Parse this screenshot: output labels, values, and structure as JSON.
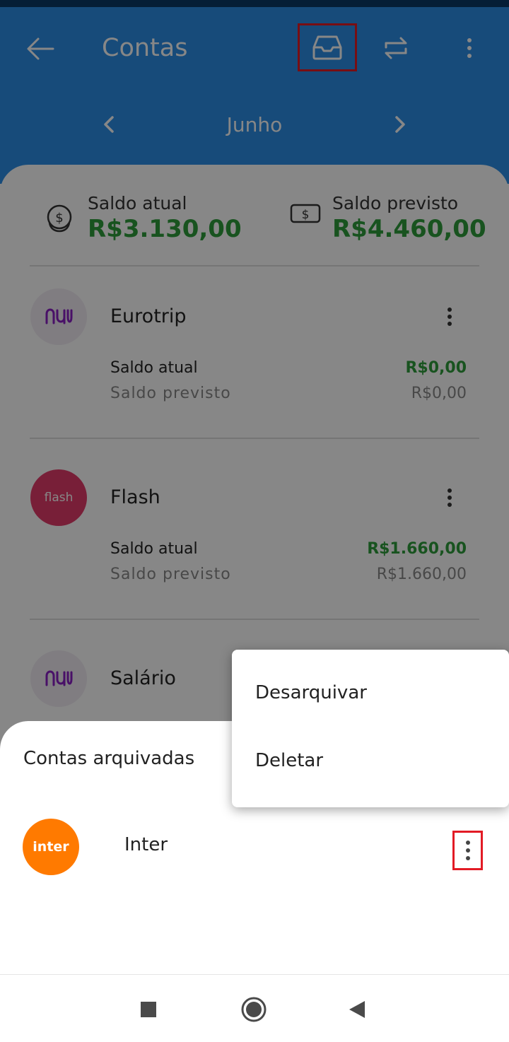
{
  "header": {
    "title": "Contas",
    "month": "Junho",
    "icons": {
      "back": "arrow-left-icon",
      "archive": "inbox-icon",
      "transfer": "transfer-icon",
      "menu": "more-vertical-icon",
      "prev": "chevron-left-icon",
      "next": "chevron-right-icon"
    }
  },
  "summary": {
    "current_label": "Saldo atual",
    "current_value": "R$3.130,00",
    "forecast_label": "Saldo previsto",
    "forecast_value": "R$4.460,00"
  },
  "accounts": [
    {
      "name": "Eurotrip",
      "logo": "nu",
      "current_label": "Saldo atual",
      "current_value": "R$0,00",
      "forecast_label": "Saldo previsto",
      "forecast_value": "R$0,00"
    },
    {
      "name": "Flash",
      "logo": "flash",
      "current_label": "Saldo atual",
      "current_value": "R$1.660,00",
      "forecast_label": "Saldo previsto",
      "forecast_value": "R$1.660,00"
    },
    {
      "name": "Salário",
      "logo": "nu"
    }
  ],
  "archived_sheet": {
    "title": "Contas arquivadas",
    "items": [
      {
        "name": "Inter",
        "logo": "inter"
      }
    ]
  },
  "popup_menu": {
    "items": [
      "Desarquivar",
      "Deletar"
    ]
  },
  "colors": {
    "header_blue": "#2c8ee6",
    "positive_green": "#2e9e3c",
    "highlight_red": "#e21b25",
    "inter_orange": "#ff7a00",
    "flash_pink": "#e23b6b"
  }
}
